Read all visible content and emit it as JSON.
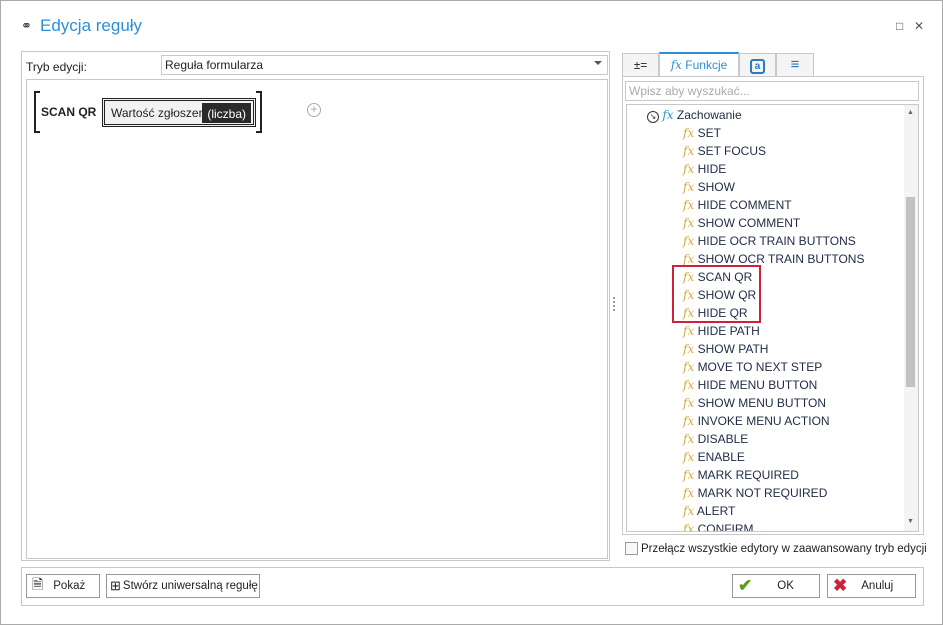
{
  "window": {
    "title": "Edycja reguły",
    "minimize": "□",
    "close": "✕"
  },
  "left": {
    "mode_label": "Tryb edycji:",
    "mode_value": "Reguła formularza",
    "function_name": "SCAN QR",
    "argument": "Wartość zgłoszenia",
    "argument_type": "(liczba)",
    "add": "+"
  },
  "tabs": [
    {
      "label": "±=",
      "icon": "variables-icon"
    },
    {
      "label": "Funkcje",
      "icon": "fx-icon"
    },
    {
      "label": "a",
      "icon": "form-fields-icon"
    },
    {
      "label": "≡",
      "icon": "list-icon"
    }
  ],
  "search": {
    "placeholder": "Wpisz aby wyszukać..."
  },
  "tree": {
    "group": "Zachowanie",
    "items": [
      "SET",
      "SET FOCUS",
      "HIDE",
      "SHOW",
      "HIDE COMMENT",
      "SHOW COMMENT",
      "HIDE OCR TRAIN BUTTONS",
      "SHOW OCR TRAIN BUTTONS",
      "SCAN QR",
      "SHOW QR",
      "HIDE QR",
      "HIDE PATH",
      "SHOW PATH",
      "MOVE TO NEXT STEP",
      "HIDE MENU BUTTON",
      "SHOW MENU BUTTON",
      "INVOKE MENU ACTION",
      "DISABLE",
      "ENABLE",
      "MARK REQUIRED",
      "MARK NOT REQUIRED",
      "ALERT",
      "CONFIRM"
    ],
    "highlighted": [
      "SCAN QR",
      "SHOW QR",
      "HIDE QR"
    ],
    "highlight_color": "#d0203a"
  },
  "advanced_checkbox": {
    "label": "Przełącz wszystkie edytory w zaawansowany tryb edycji",
    "checked": false
  },
  "buttons": {
    "show": "Pokaż",
    "universal": "Stwórz uniwersalną regułę",
    "ok": "OK",
    "cancel": "Anuluj"
  },
  "colors": {
    "accent": "#2b8fd6",
    "fx": "#d2a94a",
    "ok": "#5a9e1a",
    "cancel": "#d0203a"
  }
}
